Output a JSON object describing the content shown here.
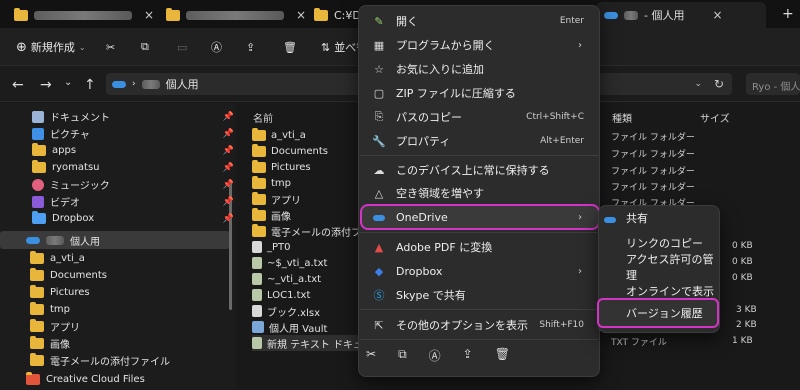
{
  "tabs": [
    {
      "label": "",
      "close": "×"
    },
    {
      "label": "",
      "close": "×"
    },
    {
      "label": "C:¥Dropl",
      "close": ""
    },
    {
      "label": "- 個人用",
      "close": "×"
    }
  ],
  "new_tab": "+",
  "toolbar": {
    "new_label": "新規作成",
    "sort_label": "並べ替"
  },
  "address": {
    "crumb": "個人用",
    "search_placeholder": "Ryo - 個人用"
  },
  "sidebar": {
    "items": [
      {
        "label": "ドキュメント",
        "icon": "document-icon",
        "pinned": true
      },
      {
        "label": "ピクチャ",
        "icon": "pictures-icon",
        "pinned": true
      },
      {
        "label": "apps",
        "icon": "folder-icon",
        "pinned": true
      },
      {
        "label": "ryomatsu",
        "icon": "folder-icon",
        "pinned": true
      },
      {
        "label": "ミュージック",
        "icon": "music-icon",
        "pinned": true
      },
      {
        "label": "ビデオ",
        "icon": "video-icon",
        "pinned": true
      },
      {
        "label": "Dropbox",
        "icon": "dropbox-folder-icon",
        "pinned": true
      },
      {
        "label": "個人用",
        "icon": "onedrive-icon",
        "pinned": false
      },
      {
        "label": "a_vti_a",
        "icon": "folder-icon",
        "pinned": false
      },
      {
        "label": "Documents",
        "icon": "folder-icon",
        "pinned": false
      },
      {
        "label": "Pictures",
        "icon": "folder-icon",
        "pinned": false
      },
      {
        "label": "tmp",
        "icon": "folder-icon",
        "pinned": false
      },
      {
        "label": "アプリ",
        "icon": "folder-icon",
        "pinned": false
      },
      {
        "label": "画像",
        "icon": "folder-icon",
        "pinned": false
      },
      {
        "label": "電子メールの添付ファイル",
        "icon": "folder-icon",
        "pinned": false
      },
      {
        "label": "Creative Cloud Files",
        "icon": "creative-cloud-icon",
        "pinned": false
      }
    ]
  },
  "filelist": {
    "col_name": "名前",
    "col_type": "種類",
    "col_size": "サイズ",
    "files": [
      {
        "name": "a_vti_a",
        "icon": "folder-icon"
      },
      {
        "name": "Documents",
        "icon": "folder-icon"
      },
      {
        "name": "Pictures",
        "icon": "folder-icon"
      },
      {
        "name": "tmp",
        "icon": "folder-icon"
      },
      {
        "name": "アプリ",
        "icon": "folder-icon"
      },
      {
        "name": "画像",
        "icon": "folder-icon"
      },
      {
        "name": "電子メールの添付ファイル",
        "icon": "folder-icon"
      },
      {
        "name": "_PT0",
        "icon": "file-icon"
      },
      {
        "name": "~$_vti_a.txt",
        "icon": "text-file-icon"
      },
      {
        "name": "~_vti_a.txt",
        "icon": "text-file-icon"
      },
      {
        "name": "LOC1.txt",
        "icon": "text-file-icon"
      },
      {
        "name": "ブック.xlsx",
        "icon": "excel-file-icon"
      },
      {
        "name": "個人用 Vault",
        "icon": "vault-icon"
      },
      {
        "name": "新規 テキスト ドキュメント.txt",
        "icon": "text-file-icon"
      }
    ],
    "types": [
      "ファイル フォルダー",
      "ファイル フォルダー",
      "ファイル フォルダー",
      "ファイル フォルダー",
      "ファイル フォルダー"
    ],
    "last_type": "TXT ファイル",
    "sizes": [
      "0 KB",
      "0 KB",
      "0 KB",
      "3 KB",
      "2 KB",
      "1 KB"
    ]
  },
  "context_menu": {
    "items": [
      {
        "label": "開く",
        "shortcut": "Enter",
        "icon": "open-icon"
      },
      {
        "label": "プログラムから開く",
        "shortcut": "",
        "icon": "open-with-icon",
        "submenu": true
      },
      {
        "label": "お気に入りに追加",
        "shortcut": "",
        "icon": "star-icon"
      },
      {
        "label": "ZIP ファイルに圧縮する",
        "shortcut": "",
        "icon": "zip-icon"
      },
      {
        "label": "パスのコピー",
        "shortcut": "Ctrl+Shift+C",
        "icon": "copy-path-icon"
      },
      {
        "label": "プロパティ",
        "shortcut": "Alt+Enter",
        "icon": "properties-icon"
      },
      {
        "label": "このデバイス上に常に保持する",
        "shortcut": "",
        "icon": "keep-on-device-icon"
      },
      {
        "label": "空き領域を増やす",
        "shortcut": "",
        "icon": "free-space-icon"
      },
      {
        "label": "OneDrive",
        "shortcut": "",
        "icon": "onedrive-icon",
        "submenu": true
      },
      {
        "label": "Adobe PDF に変換",
        "shortcut": "",
        "icon": "adobe-pdf-icon"
      },
      {
        "label": "Dropbox",
        "shortcut": "",
        "icon": "dropbox-icon",
        "submenu": true
      },
      {
        "label": "Skype で共有",
        "shortcut": "",
        "icon": "skype-icon"
      },
      {
        "label": "その他のオプションを表示",
        "shortcut": "Shift+F10",
        "icon": "more-options-icon"
      }
    ]
  },
  "onedrive_submenu": {
    "items": [
      "共有",
      "リンクのコピー",
      "アクセス許可の管理",
      "オンラインで表示",
      "バージョン履歴"
    ]
  },
  "colors": {
    "highlight": "#d433c7",
    "onedrive": "#3b8fe0",
    "folder": "#e8b63a"
  }
}
